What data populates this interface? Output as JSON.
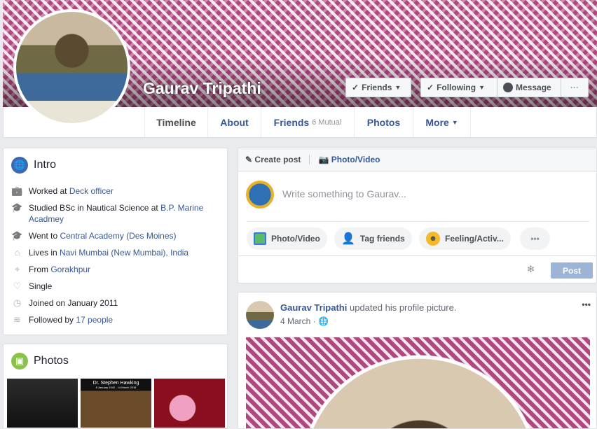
{
  "profile": {
    "name": "Gaurav Tripathi"
  },
  "cover_buttons": {
    "friends": "Friends",
    "following": "Following",
    "message": "Message",
    "more": "···"
  },
  "tabs": [
    {
      "label": "Timeline"
    },
    {
      "label": "About"
    },
    {
      "label": "Friends",
      "sub": "6 Mutual"
    },
    {
      "label": "Photos"
    },
    {
      "label": "More"
    }
  ],
  "intro": {
    "title": "Intro",
    "items": [
      {
        "icon": "briefcase-icon",
        "text": "Worked at ",
        "link": "Deck officer"
      },
      {
        "icon": "graduation-cap-icon",
        "text": "Studied BSc in Nautical Science at ",
        "link": "B.P. Marine Acadmey"
      },
      {
        "icon": "graduation-cap-icon",
        "text": "Went to ",
        "link": "Central Academy (Des Moines)"
      },
      {
        "icon": "home-icon",
        "text": "Lives in ",
        "link": "Navi Mumbai (New Mumbai), India"
      },
      {
        "icon": "location-pin-icon",
        "text": "From ",
        "link": "Gorakhpur"
      },
      {
        "icon": "heart-icon",
        "text": "Single",
        "link": ""
      },
      {
        "icon": "clock-icon",
        "text": "Joined on January 2011",
        "link": ""
      },
      {
        "icon": "rss-icon",
        "text": "Followed by ",
        "link": "17 people"
      }
    ]
  },
  "photos": {
    "title": "Photos",
    "items": [
      {
        "caption": ""
      },
      {
        "caption": "Dr. Stephen Hawking",
        "sub": "8 January 1942 - 14 March 2018"
      },
      {
        "caption": ""
      }
    ]
  },
  "composer": {
    "tab_create": "Create post",
    "tab_photo": "Photo/Video",
    "placeholder": "Write something to Gaurav...",
    "actions": [
      "Photo/Video",
      "Tag friends",
      "Feeling/Activ...",
      "•••"
    ],
    "post": "Post"
  },
  "post": {
    "author": "Gaurav Tripathi",
    "action": " updated his profile picture.",
    "date": "4 March",
    "separator": "·",
    "menu": "•••"
  },
  "colors": {
    "link": "#365899",
    "post_button": "#9cb4d8",
    "bg": "#e9ebee"
  }
}
